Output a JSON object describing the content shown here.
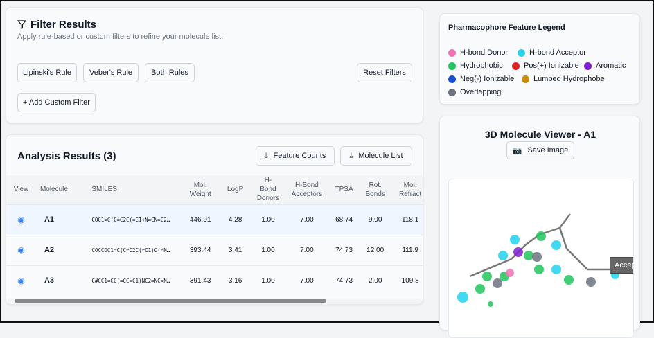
{
  "filter": {
    "title": "Filter Results",
    "subtitle": "Apply rule-based or custom filters to refine your molecule list.",
    "buttons": [
      "Lipinski's Rule",
      "Veber's Rule",
      "Both Rules"
    ],
    "reset": "Reset Filters",
    "add_custom": "+ Add Custom Filter"
  },
  "results": {
    "title": "Analysis Results (3)",
    "feature_counts": "Feature Counts",
    "molecule_list": "Molecule List",
    "columns": [
      "View",
      "Molecule",
      "SMILES",
      "Mol. Weight",
      "LogP",
      "H- Bond Donors",
      "H-Bond Acceptors",
      "TPSA",
      "Rot. Bonds",
      "Mol. Refract"
    ],
    "rows": [
      {
        "name": "A1",
        "smiles": "COC1=C(C=C2C(=C1)N=CN=C2…",
        "mw": "446.91",
        "logp": "4.28",
        "hbd": "1.00",
        "hba": "7.00",
        "tpsa": "68.74",
        "rot": "9.00",
        "mr": "118.1"
      },
      {
        "name": "A2",
        "smiles": "COCCOC1=C(C=C2C(=C1)C(=N…",
        "mw": "393.44",
        "logp": "3.41",
        "hbd": "1.00",
        "hba": "7.00",
        "tpsa": "74.73",
        "rot": "12.00",
        "mr": "111.9"
      },
      {
        "name": "A3",
        "smiles": "C#CC1=CC(=CC=C1)NC2=NC=N…",
        "mw": "391.43",
        "logp": "3.16",
        "hbd": "1.00",
        "hba": "7.00",
        "tpsa": "74.73",
        "rot": "2.00",
        "mr": "109.8"
      }
    ]
  },
  "legend": {
    "title": "Pharmacophore Feature Legend",
    "items": [
      {
        "label": "H-bond Donor",
        "color": "#f472b6"
      },
      {
        "label": "H-bond Acceptor",
        "color": "#22d3ee"
      },
      {
        "label": "Hydrophobic",
        "color": "#22c55e"
      },
      {
        "label": "Pos(+) Ionizable",
        "color": "#dc2626"
      },
      {
        "label": "Aromatic",
        "color": "#7e22ce"
      },
      {
        "label": "Neg(-) Ionizable",
        "color": "#1d4ed8"
      },
      {
        "label": "Lumped Hydrophobe",
        "color": "#ca8a04"
      },
      {
        "label": "Overlapping",
        "color": "#6b7280"
      }
    ]
  },
  "viewer": {
    "title": "3D Molecule Viewer - A1",
    "save": "Save Image",
    "tooltip": "Acceptor"
  }
}
